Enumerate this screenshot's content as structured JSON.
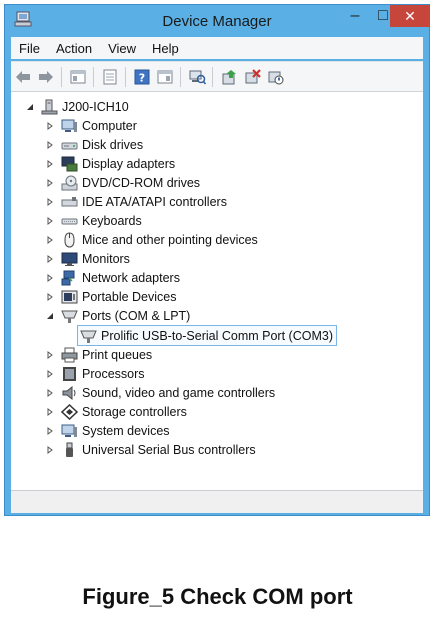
{
  "window": {
    "title": "Device Manager",
    "minimize": "–",
    "maximize": "□",
    "close": "✕"
  },
  "menu": [
    {
      "label": "File"
    },
    {
      "label": "Action"
    },
    {
      "label": "View"
    },
    {
      "label": "Help"
    }
  ],
  "toolbar_icons": [
    "back-icon",
    "forward-icon",
    "properties-view-icon",
    "properties-icon",
    "help-icon",
    "show-hidden-icon",
    "scan-hardware-icon",
    "update-driver-icon",
    "uninstall-icon",
    "disable-icon"
  ],
  "tree": {
    "root": "J200-ICH10",
    "items": [
      {
        "label": "Computer",
        "icon": "computer-icon"
      },
      {
        "label": "Disk drives",
        "icon": "disk-drive-icon"
      },
      {
        "label": "Display adapters",
        "icon": "display-adapter-icon"
      },
      {
        "label": "DVD/CD-ROM drives",
        "icon": "dvd-drive-icon"
      },
      {
        "label": "IDE ATA/ATAPI controllers",
        "icon": "ide-controller-icon"
      },
      {
        "label": "Keyboards",
        "icon": "keyboard-icon"
      },
      {
        "label": "Mice and other pointing devices",
        "icon": "mouse-icon"
      },
      {
        "label": "Monitors",
        "icon": "monitor-icon"
      },
      {
        "label": "Network adapters",
        "icon": "network-adapter-icon"
      },
      {
        "label": "Portable Devices",
        "icon": "portable-device-icon"
      },
      {
        "label": "Ports (COM & LPT)",
        "icon": "port-icon",
        "expanded": true,
        "children": [
          {
            "label": "Prolific USB-to-Serial Comm Port (COM3)",
            "icon": "serial-port-icon"
          }
        ]
      },
      {
        "label": "Print queues",
        "icon": "printer-icon"
      },
      {
        "label": "Processors",
        "icon": "processor-icon"
      },
      {
        "label": "Sound, video and game controllers",
        "icon": "speaker-icon"
      },
      {
        "label": "Storage controllers",
        "icon": "storage-controller-icon"
      },
      {
        "label": "System devices",
        "icon": "system-device-icon"
      },
      {
        "label": "Universal Serial Bus controllers",
        "icon": "usb-icon"
      }
    ]
  },
  "caption": "Figure_5 Check COM port"
}
